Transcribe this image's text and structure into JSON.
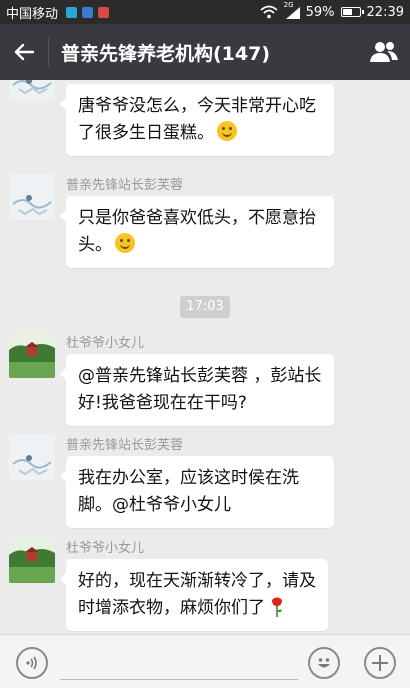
{
  "status_bar": {
    "carrier": "中国移动",
    "network": "2G",
    "battery": "59%",
    "battery_level": 0.59,
    "time": "22:39"
  },
  "header": {
    "title": "普亲先锋养老机构(147)"
  },
  "messages": [
    {
      "sender": "",
      "text": "唐爷爷没怎么，今天非常开心吃了很多生日蛋糕。",
      "emoji": "smile"
    },
    {
      "sender": "普亲先锋站长彭芙蓉",
      "text": "只是你爸爸喜欢低头，不愿意抬头。",
      "emoji": "smile"
    },
    {
      "sender": "杜爷爷小女儿",
      "text": "@普亲先锋站长彭芙蓉 ，彭站长好!我爸爸现在在干吗?"
    },
    {
      "sender": "普亲先锋站长彭芙蓉",
      "text": "我在办公室，应该这时侯在洗脚。@杜爷爷小女儿"
    },
    {
      "sender": "杜爷爷小女儿",
      "text": "好的，现在天渐渐转冷了，请及时增添衣物，麻烦你们了",
      "emoji": "rose"
    }
  ],
  "timestamp": "17:03",
  "colors": {
    "header_bg": "#393a3f",
    "chat_bg": "#ebebeb",
    "bubble_bg": "#ffffff"
  }
}
